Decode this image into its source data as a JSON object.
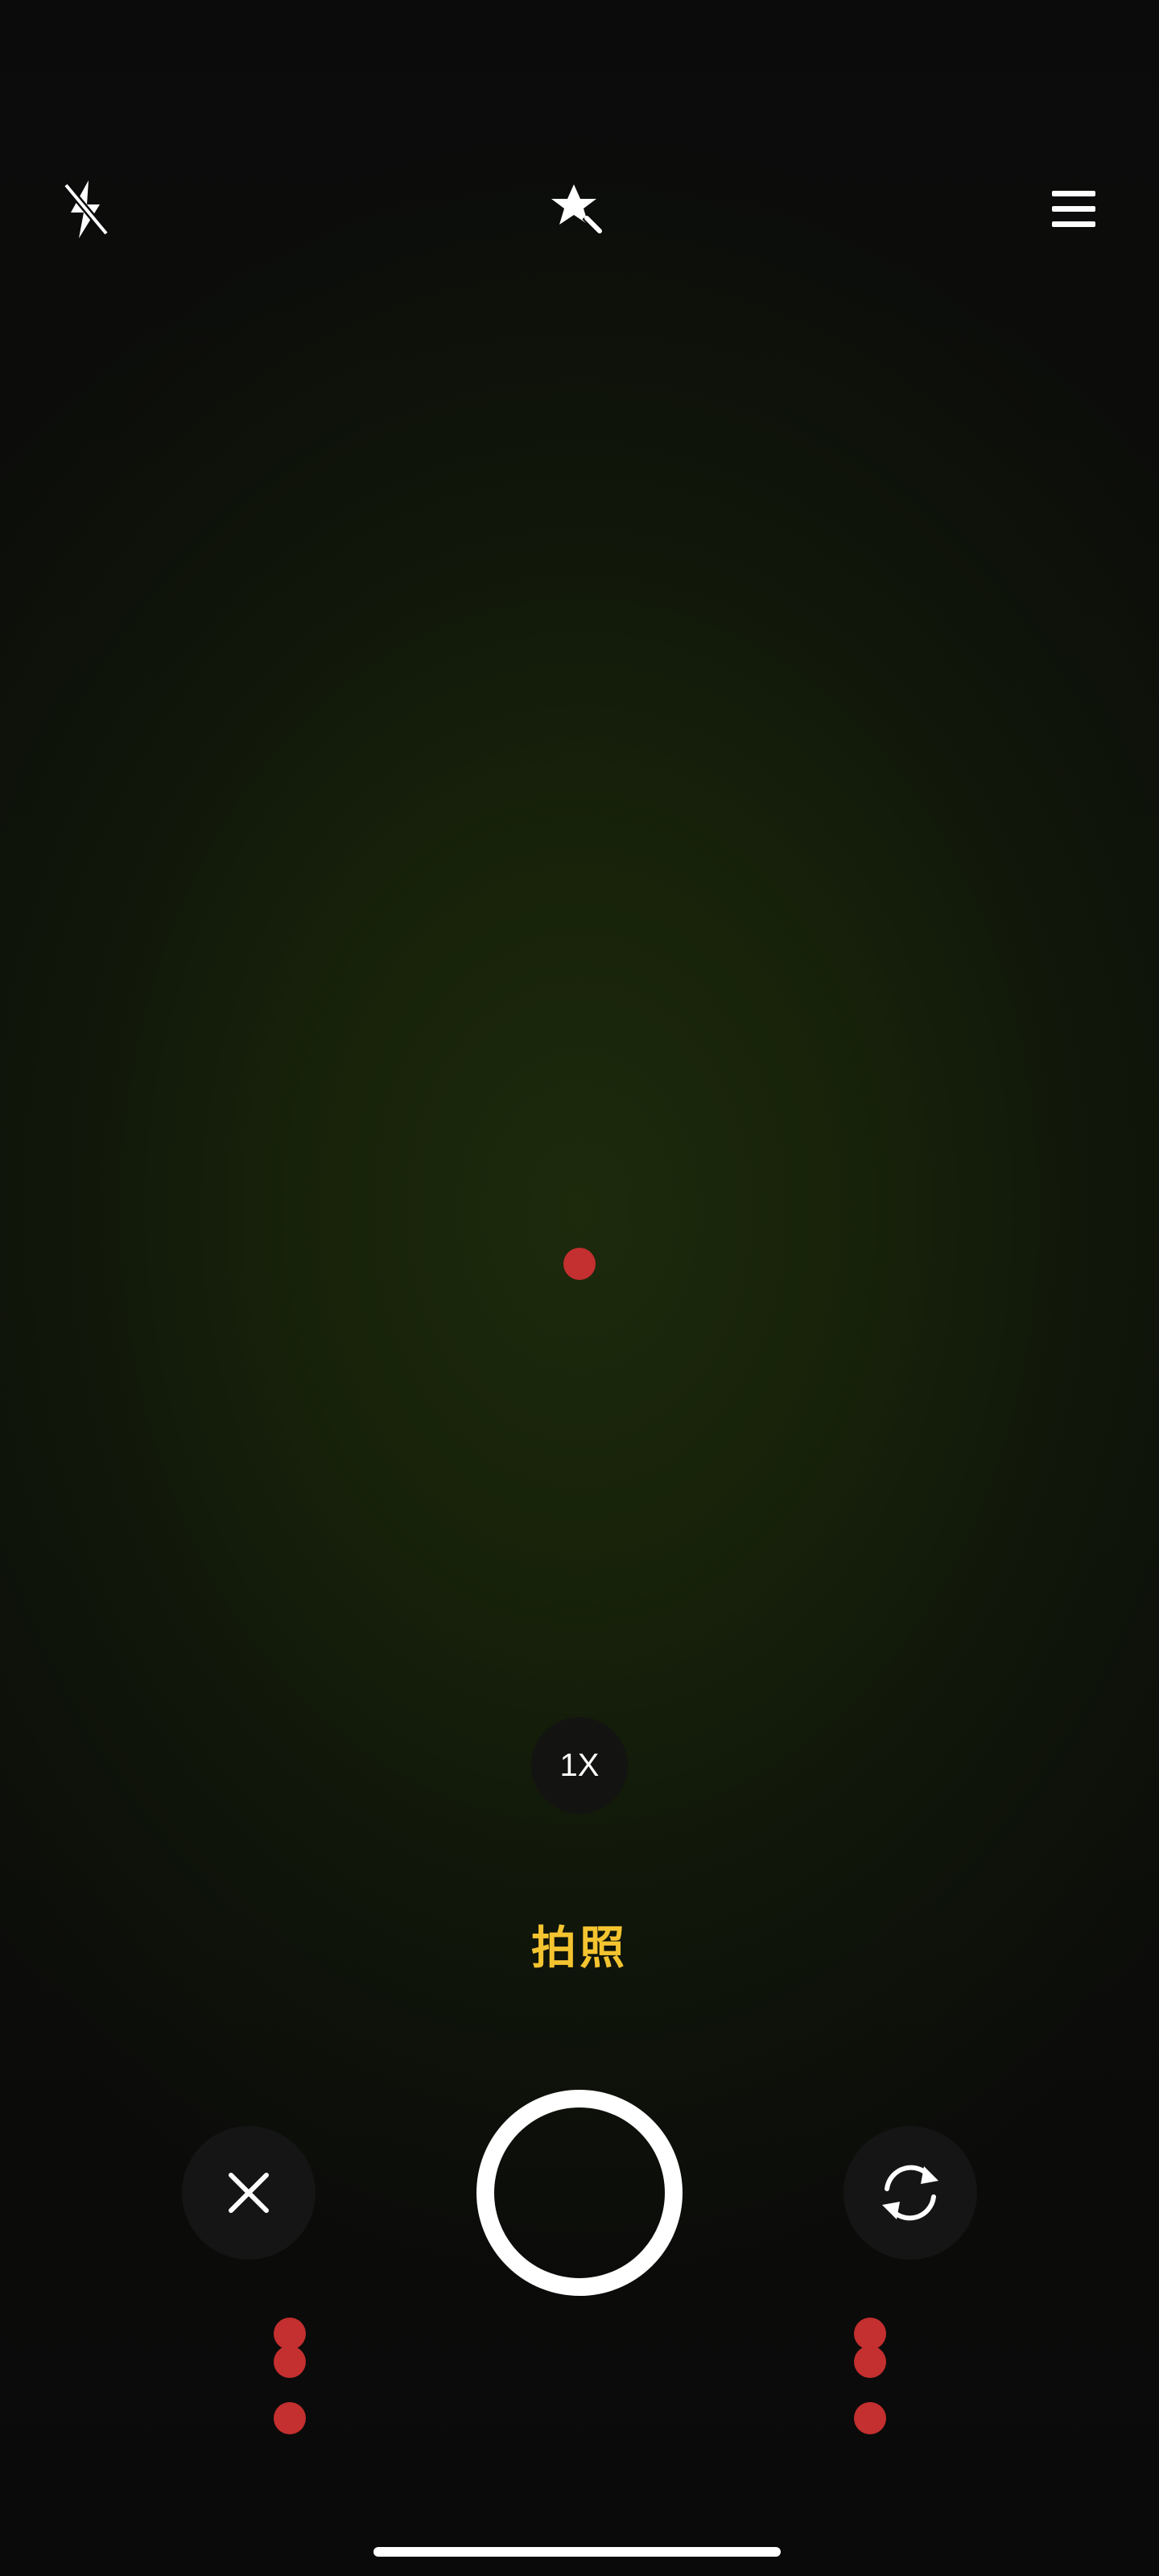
{
  "top_bar": {
    "flash_icon": "flash-off-icon",
    "effects_icon": "magic-wand-icon",
    "menu_icon": "menu-icon"
  },
  "zoom": {
    "label": "1X"
  },
  "mode": {
    "label": "拍照"
  },
  "bottom_bar": {
    "close_icon": "close-icon",
    "shutter": "shutter-button",
    "switch_icon": "switch-camera-icon"
  },
  "colors": {
    "accent": "#f4c430",
    "marker": "#c42f2f",
    "foreground": "#ffffff"
  }
}
